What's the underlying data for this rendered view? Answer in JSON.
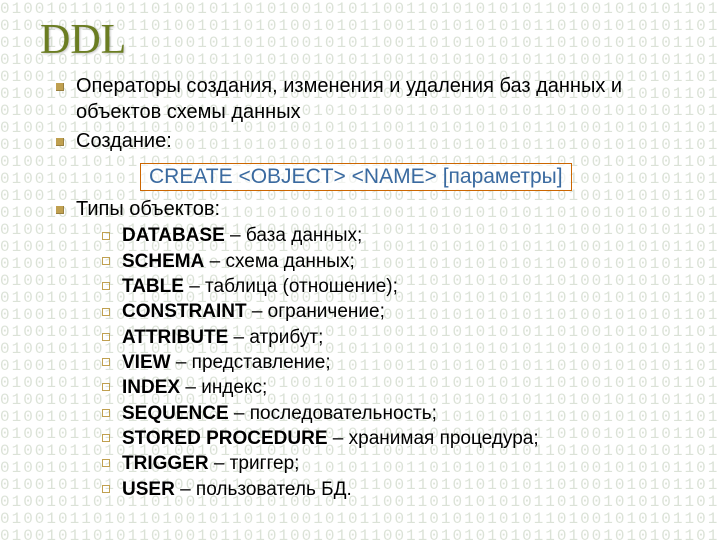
{
  "title": "DDL",
  "bullets": [
    "Операторы создания, изменения и удаления баз данных и объектов схемы данных",
    "Создание:"
  ],
  "syntax": "CREATE <OBJECT> <NAME> [параметры]",
  "types_label": "Типы объектов:",
  "types": [
    {
      "kw": "DATABASE",
      "desc": " – база данных;"
    },
    {
      "kw": "SCHEMA",
      "desc": " – схема данных;"
    },
    {
      "kw": "TABLE",
      "desc": " – таблица (отношение);"
    },
    {
      "kw": "CONSTRAINT",
      "desc": " – ограничение;"
    },
    {
      "kw": "ATTRIBUTE",
      "desc": " – атрибут;"
    },
    {
      "kw": "VIEW",
      "desc": " – представление;"
    },
    {
      "kw": "INDEX",
      "desc": " – индекс;"
    },
    {
      "kw": "SEQUENCE",
      "desc": " – последовательность;"
    },
    {
      "kw": "STORED PROCEDURE",
      "desc": " – хранимая процедура;"
    },
    {
      "kw": "TRIGGER",
      "desc": " – триггер;"
    },
    {
      "kw": "USER",
      "desc": " – пользователь БД."
    }
  ],
  "bg_pattern": "01001011010110100101101010010101100110101010101101001010101101010010110101011"
}
